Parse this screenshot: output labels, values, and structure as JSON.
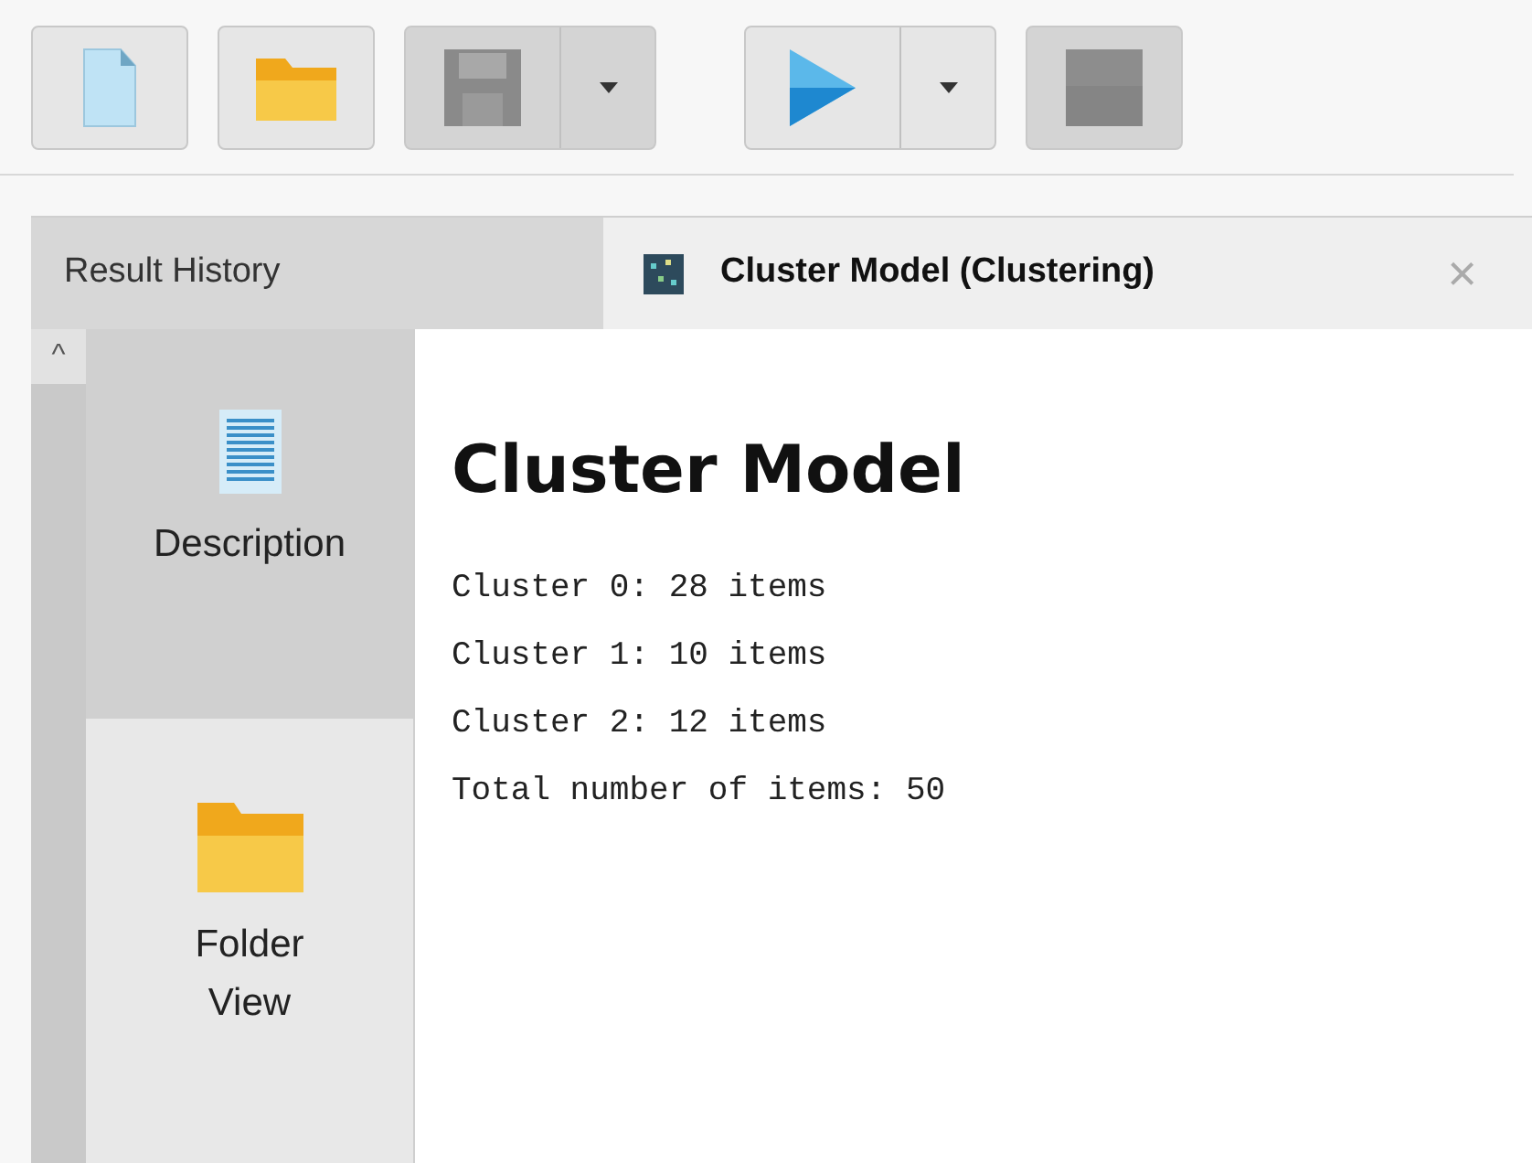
{
  "toolbar": [
    {
      "kind": "new",
      "disabled": false,
      "dropdown": false
    },
    {
      "kind": "open",
      "disabled": false,
      "dropdown": false
    },
    {
      "kind": "save",
      "disabled": true,
      "dropdown": true
    },
    {
      "kind": "run",
      "disabled": false,
      "dropdown": true
    },
    {
      "kind": "stop",
      "disabled": true,
      "dropdown": false
    }
  ],
  "tabs": [
    {
      "label": "Result History",
      "selected": false,
      "closable": false,
      "icon": false
    },
    {
      "label": "Cluster Model (Clustering)",
      "selected": true,
      "closable": true,
      "icon": true
    }
  ],
  "close_glyph": "×",
  "scroll_glyph": "^",
  "sidebar": {
    "items": [
      {
        "kind": "document",
        "label": "Description",
        "selected": true
      },
      {
        "kind": "folder",
        "label": "Folder View",
        "selected": false
      }
    ]
  },
  "content": {
    "title": "Cluster Model",
    "lines": [
      "Cluster 0: 28 items",
      "Cluster 1: 10 items",
      "Cluster 2: 12 items",
      "Total number of items: 50"
    ]
  }
}
